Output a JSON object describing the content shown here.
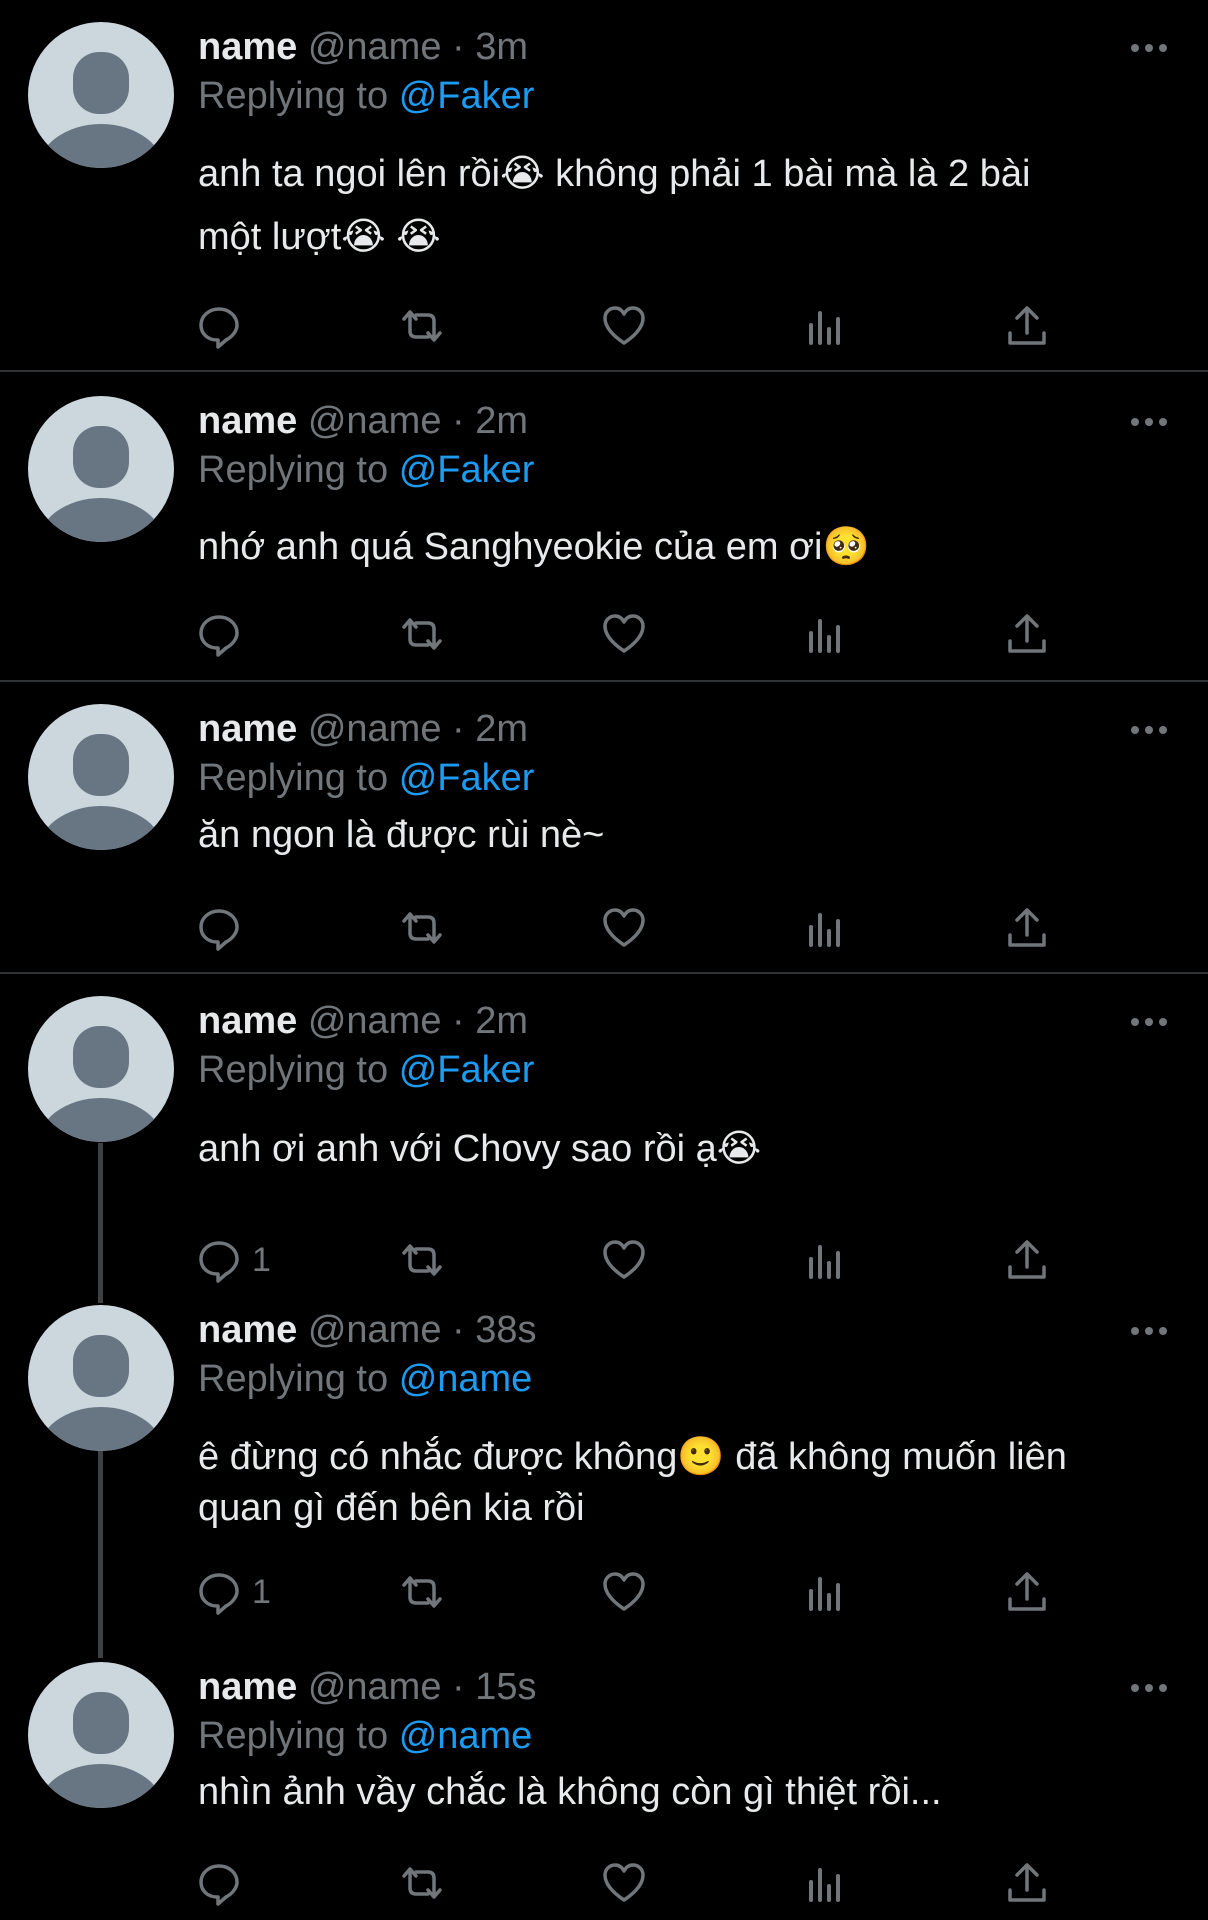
{
  "theme": {
    "background": "#000000",
    "text": "#e7e9ea",
    "muted": "#71767b",
    "accent": "#1d9bf0",
    "avatar_bg": "#ccd6dd",
    "avatar_fg": "#687684"
  },
  "tweets": [
    {
      "name": "name",
      "handle": "@name",
      "dot": "·",
      "time": "3m",
      "replying_prefix": "Replying to",
      "replying_to": "@Faker",
      "lines": [
        "anh ta ngoi lên rồi😭  không phải 1 bài mà là 2 bài",
        "một lượt😭 😭"
      ],
      "reply_count": ""
    },
    {
      "name": "name",
      "handle": "@name",
      "dot": "·",
      "time": "2m",
      "replying_prefix": "Replying to",
      "replying_to": "@Faker",
      "lines": [
        "nhớ anh quá Sanghyeokie của em ơi🥺"
      ],
      "reply_count": ""
    },
    {
      "name": "name",
      "handle": "@name",
      "dot": "·",
      "time": "2m",
      "replying_prefix": "Replying to",
      "replying_to": "@Faker",
      "lines": [
        "ăn ngon là được rùi nè~"
      ],
      "reply_count": ""
    },
    {
      "name": "name",
      "handle": "@name",
      "dot": "·",
      "time": "2m",
      "replying_prefix": "Replying to",
      "replying_to": "@Faker",
      "lines": [
        "anh ơi anh với Chovy sao rồi ạ😭"
      ],
      "reply_count": "1"
    },
    {
      "name": "name",
      "handle": "@name",
      "dot": "·",
      "time": "38s",
      "replying_prefix": "Replying to",
      "replying_to": "@name",
      "lines": [
        "ê đừng có nhắc được không🙂  đã không muốn liên",
        "quan gì đến bên kia rồi"
      ],
      "reply_count": "1"
    },
    {
      "name": "name",
      "handle": "@name",
      "dot": "·",
      "time": "15s",
      "replying_prefix": "Replying to",
      "replying_to": "@name",
      "lines": [
        "nhìn ảnh vầy chắc là không còn gì thiệt rồi..."
      ],
      "reply_count": ""
    }
  ]
}
